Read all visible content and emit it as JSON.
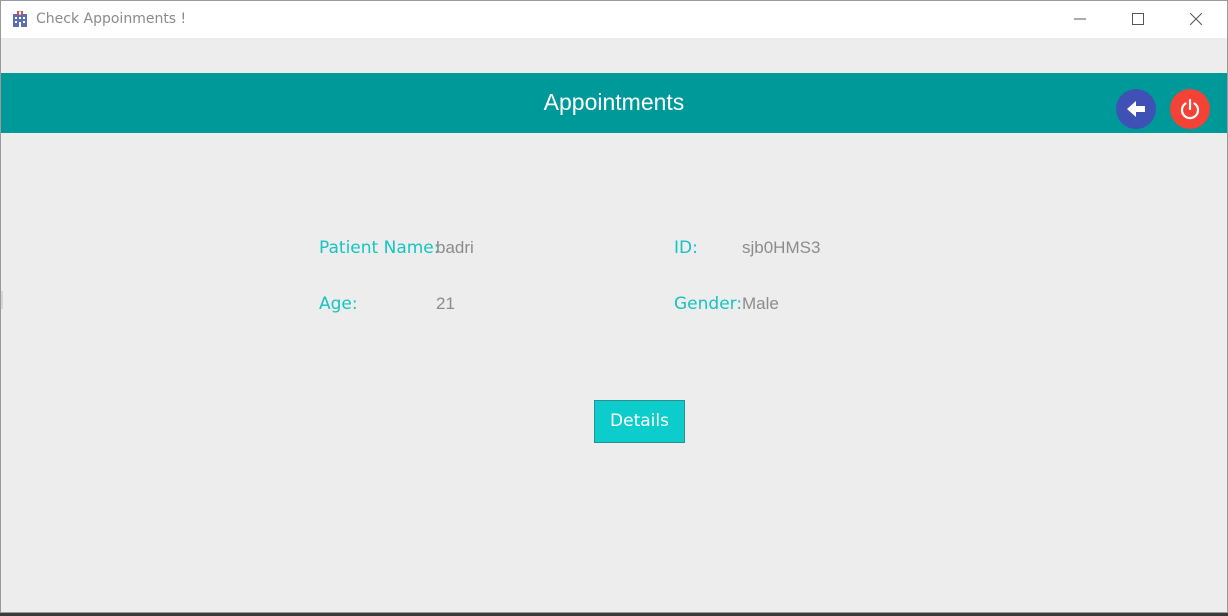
{
  "window": {
    "title": "Check Appoinments !"
  },
  "header": {
    "title": "Appointments",
    "back_icon": "arrow-left-icon",
    "power_icon": "power-icon",
    "colors": {
      "bar": "#009999",
      "back": "#3f51b5",
      "power": "#f44336"
    }
  },
  "patient": {
    "name_label": "Patient Name:",
    "name_value": "badri",
    "id_label": "ID:",
    "id_value": "sjb0HMS3",
    "age_label": "Age:",
    "age_value": "21",
    "gender_label": "Gender:",
    "gender_value": "Male"
  },
  "actions": {
    "details_label": "Details"
  }
}
